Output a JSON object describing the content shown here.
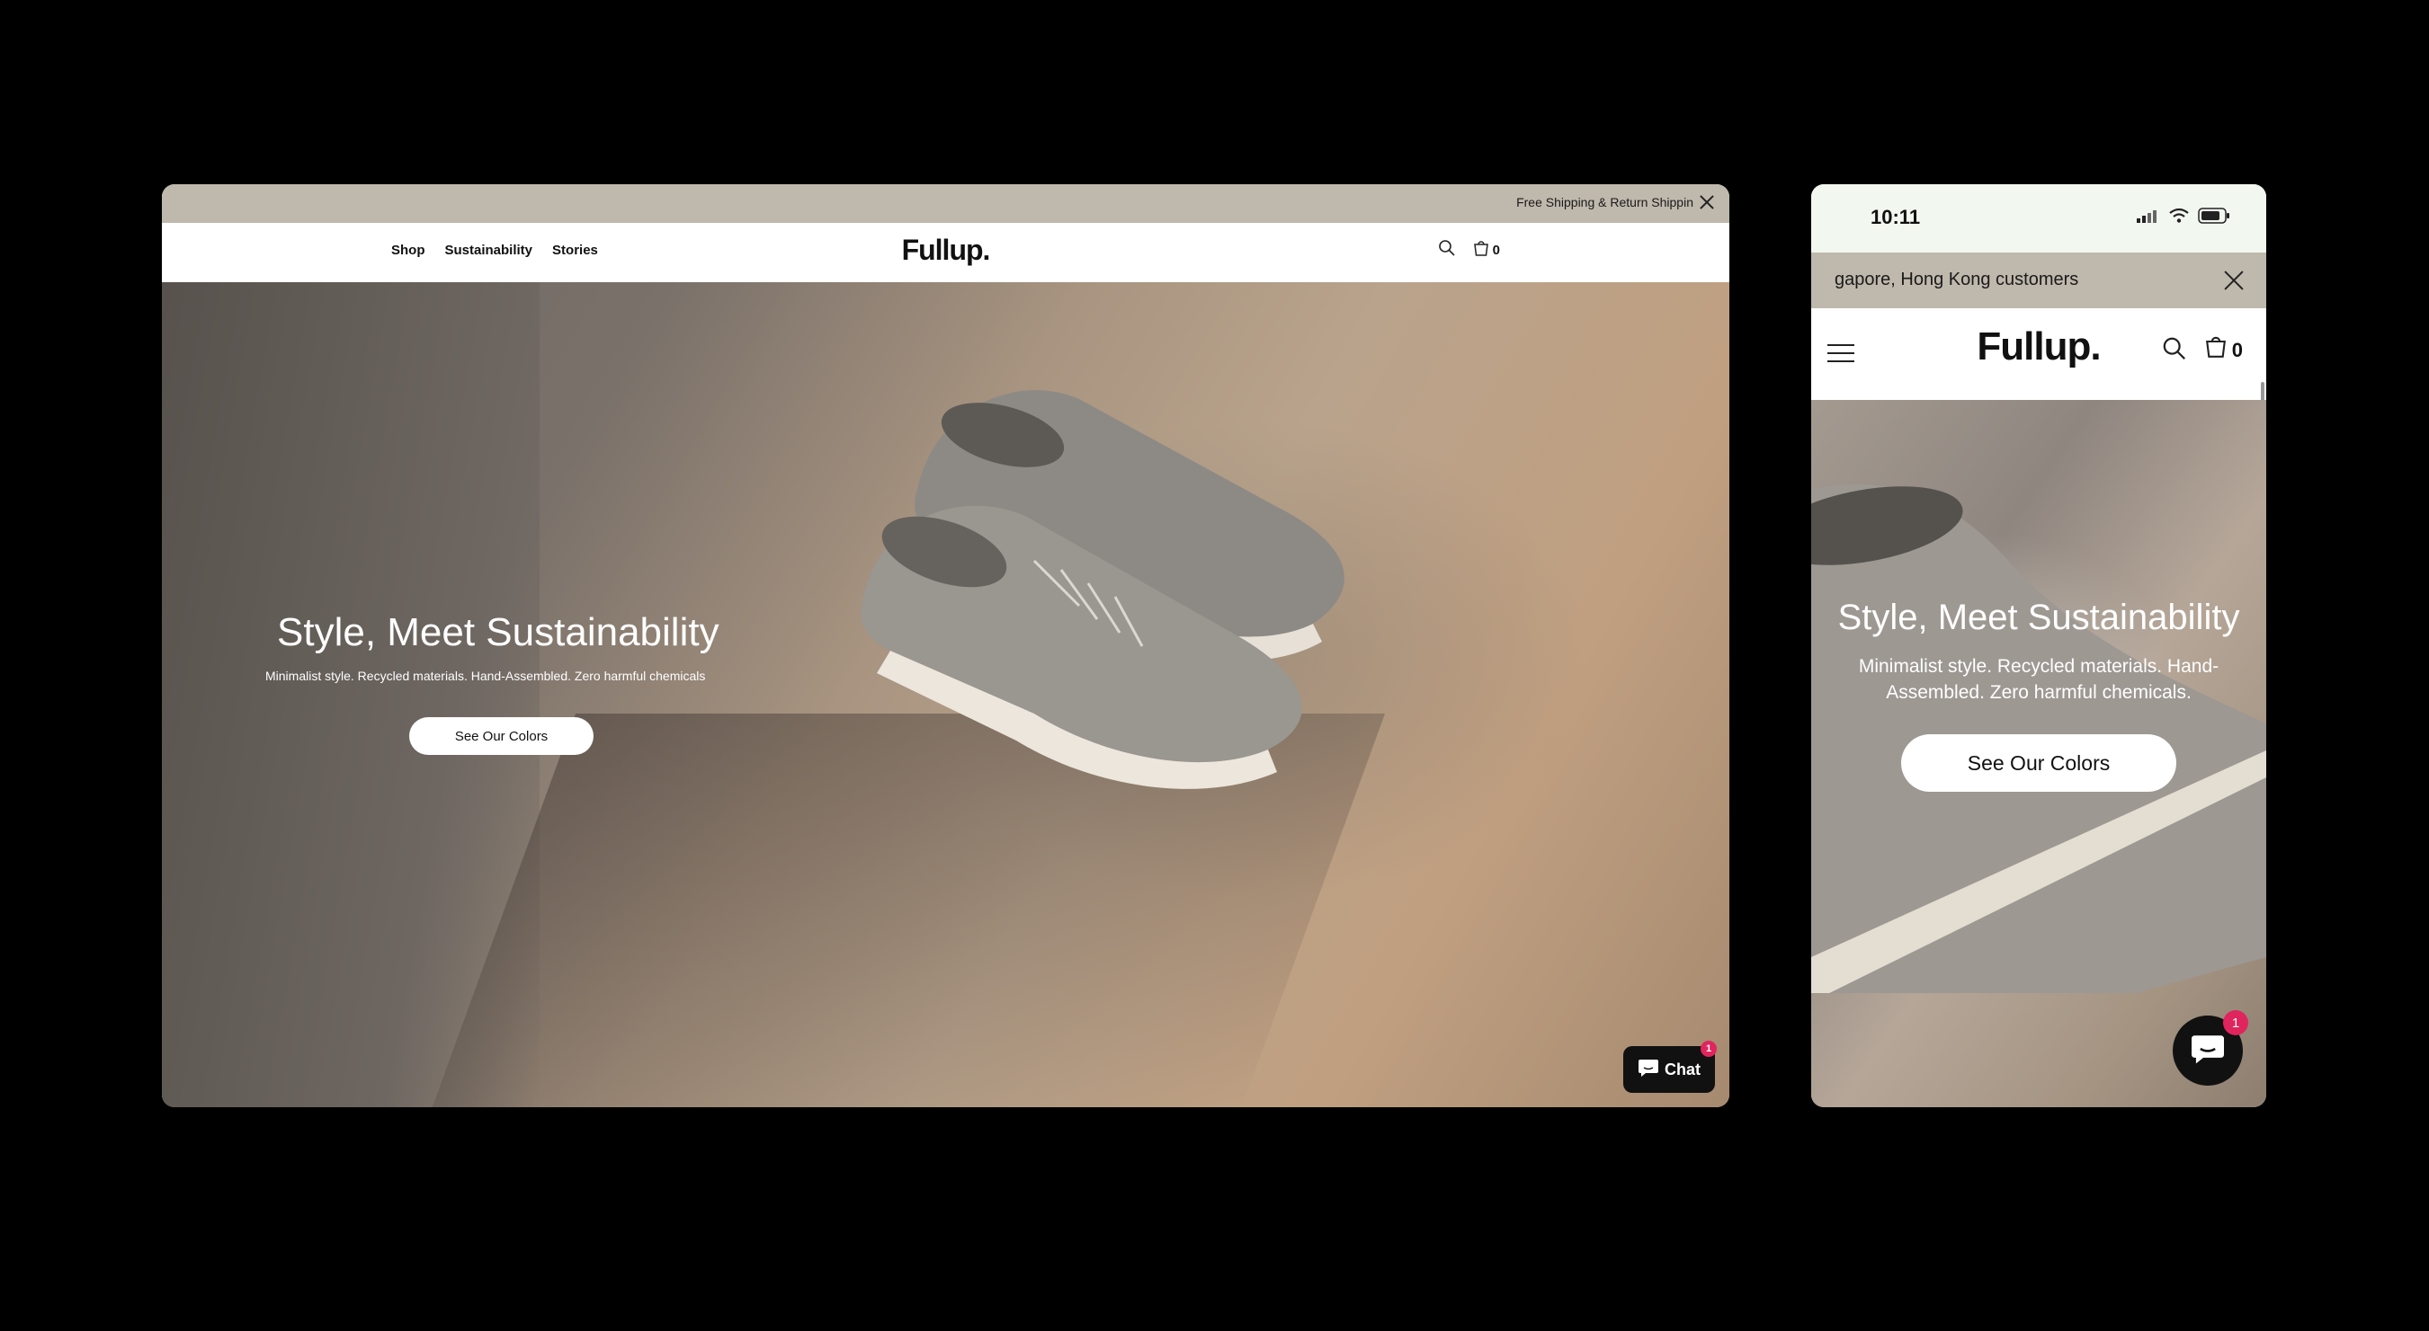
{
  "desktop": {
    "announcement": {
      "text": "Free Shipping & Return Shippin"
    },
    "header": {
      "nav": [
        {
          "label": "Shop"
        },
        {
          "label": "Sustainability"
        },
        {
          "label": "Stories"
        }
      ],
      "logo": "Fullup.",
      "cart_count": "0"
    },
    "hero": {
      "title": "Style, Meet Sustainability",
      "subtitle": "Minimalist style. Recycled materials. Hand-Assembled. Zero harmful chemicals",
      "button": "See Our Colors"
    },
    "chat": {
      "label": "Chat",
      "badge": "1"
    }
  },
  "mobile": {
    "status": {
      "time": "10:11"
    },
    "announcement": {
      "text": "gapore, Hong Kong customers"
    },
    "header": {
      "logo": "Fullup.",
      "cart_count": "0"
    },
    "hero": {
      "title": "Style, Meet Sustainability",
      "subtitle": "Minimalist style. Recycled materials. Hand-Assembled. Zero harmful chemicals.",
      "button": "See Our Colors"
    },
    "chat": {
      "badge": "1"
    }
  },
  "colors": {
    "announcement_bg": "#bfb8ac",
    "background": "#000000",
    "chat_bg": "#111111",
    "badge": "#e0245e"
  },
  "icons": [
    "close-icon",
    "search-icon",
    "cart-icon",
    "chat-icon",
    "menu-icon",
    "signal-icon",
    "wifi-icon",
    "battery-icon"
  ]
}
